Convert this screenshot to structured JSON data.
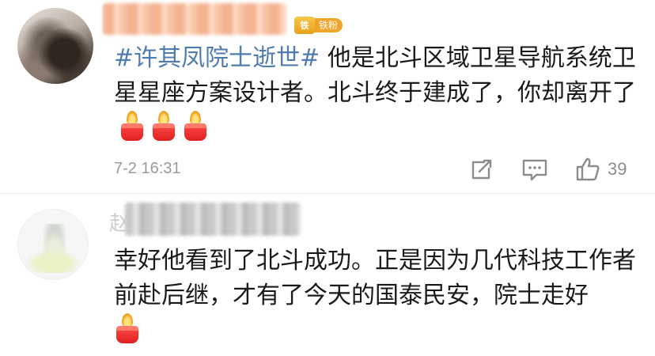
{
  "comments": [
    {
      "topic": "#许其凤院士逝世#",
      "text": " 他是北斗区域卫星导航系统卫星星座方案设计者。北斗终于建成了，你却离开了",
      "fan_badge": {
        "icon": "铁",
        "label": "铁粉"
      },
      "emoji": [
        "candle-emoji",
        "candle-emoji",
        "candle-emoji"
      ],
      "time": "7-2 16:31",
      "likes": "39",
      "icons": [
        "share-icon",
        "comment-icon",
        "like-icon"
      ]
    },
    {
      "name_initial": "赵",
      "text": "幸好他看到了北斗成功。正是因为几代科技工作者前赴后继，才有了今天的国泰民安，院士走好",
      "emoji": [
        "candle-emoji"
      ]
    }
  ],
  "colors": {
    "topic": "#4f7cae",
    "badge": "#f0a52a",
    "meta": "#9a9a9a"
  }
}
